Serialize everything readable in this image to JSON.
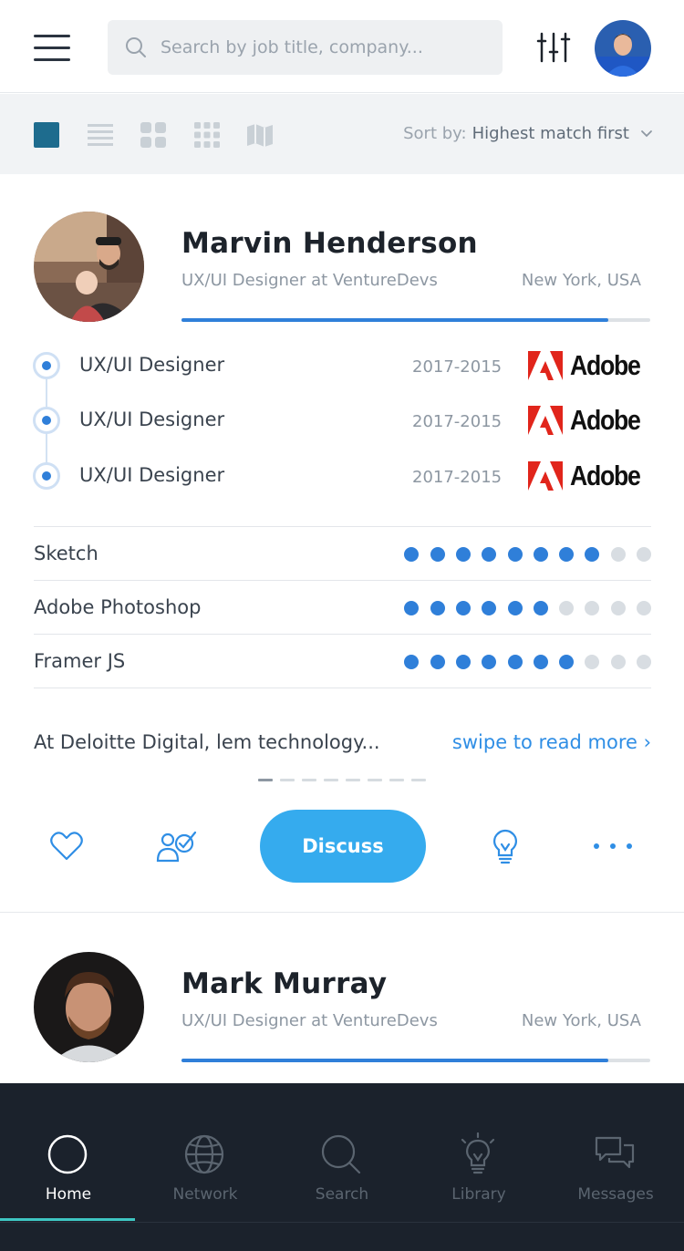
{
  "header": {
    "search_placeholder": "Search by job title, company...",
    "menu_icon": "hamburger-icon",
    "filter_icon": "sliders-icon"
  },
  "toolbar": {
    "views": [
      "card-view-icon",
      "list-view-icon",
      "grid-2x2-icon",
      "grid-3x3-icon",
      "map-view-icon"
    ],
    "active_view": "card-view-icon",
    "sort_label": "Sort by:",
    "sort_value": "Highest match first"
  },
  "profiles": [
    {
      "name": "Marvin Henderson",
      "role": "UX/UI Designer at VentureDevs",
      "location": "New York, USA",
      "match": 0.91,
      "experience": [
        {
          "title": "UX/UI Designer",
          "years": "2017-2015",
          "company": "Adobe"
        },
        {
          "title": "UX/UI Designer",
          "years": "2017-2015",
          "company": "Adobe"
        },
        {
          "title": "UX/UI Designer",
          "years": "2017-2015",
          "company": "Adobe"
        }
      ],
      "skills": [
        {
          "name": "Sketch",
          "level": 8,
          "max": 10
        },
        {
          "name": "Adobe Photoshop",
          "level": 6,
          "max": 10
        },
        {
          "name": "Framer JS",
          "level": 7,
          "max": 10
        }
      ],
      "summary": "At Deloitte Digital, lem technology...",
      "read_more": "swipe to read more ›",
      "pager": {
        "count": 8,
        "active": 0
      },
      "actions": {
        "discuss_label": "Discuss",
        "icons": [
          "heart-icon",
          "people-check-icon",
          "lightbulb-icon",
          "more-icon"
        ]
      }
    },
    {
      "name": "Mark Murray",
      "role": "UX/UI Designer at VentureDevs",
      "location": "New York, USA",
      "match": 0.91
    }
  ],
  "bottom_nav": {
    "items": [
      {
        "label": "Home",
        "icon": "home-circle-icon",
        "active": true
      },
      {
        "label": "Network",
        "icon": "globe-icon",
        "active": false
      },
      {
        "label": "Search",
        "icon": "search-icon",
        "active": false
      },
      {
        "label": "Library",
        "icon": "lightbulb-icon",
        "active": false
      },
      {
        "label": "Messages",
        "icon": "chat-bubbles-icon",
        "active": false
      }
    ]
  },
  "colors": {
    "accent": "#2f7fd9",
    "button": "#35abee",
    "nav_bg": "#1b222c",
    "nav_active_underline": "#3ec6c2",
    "adobe_red": "#e1251b"
  }
}
